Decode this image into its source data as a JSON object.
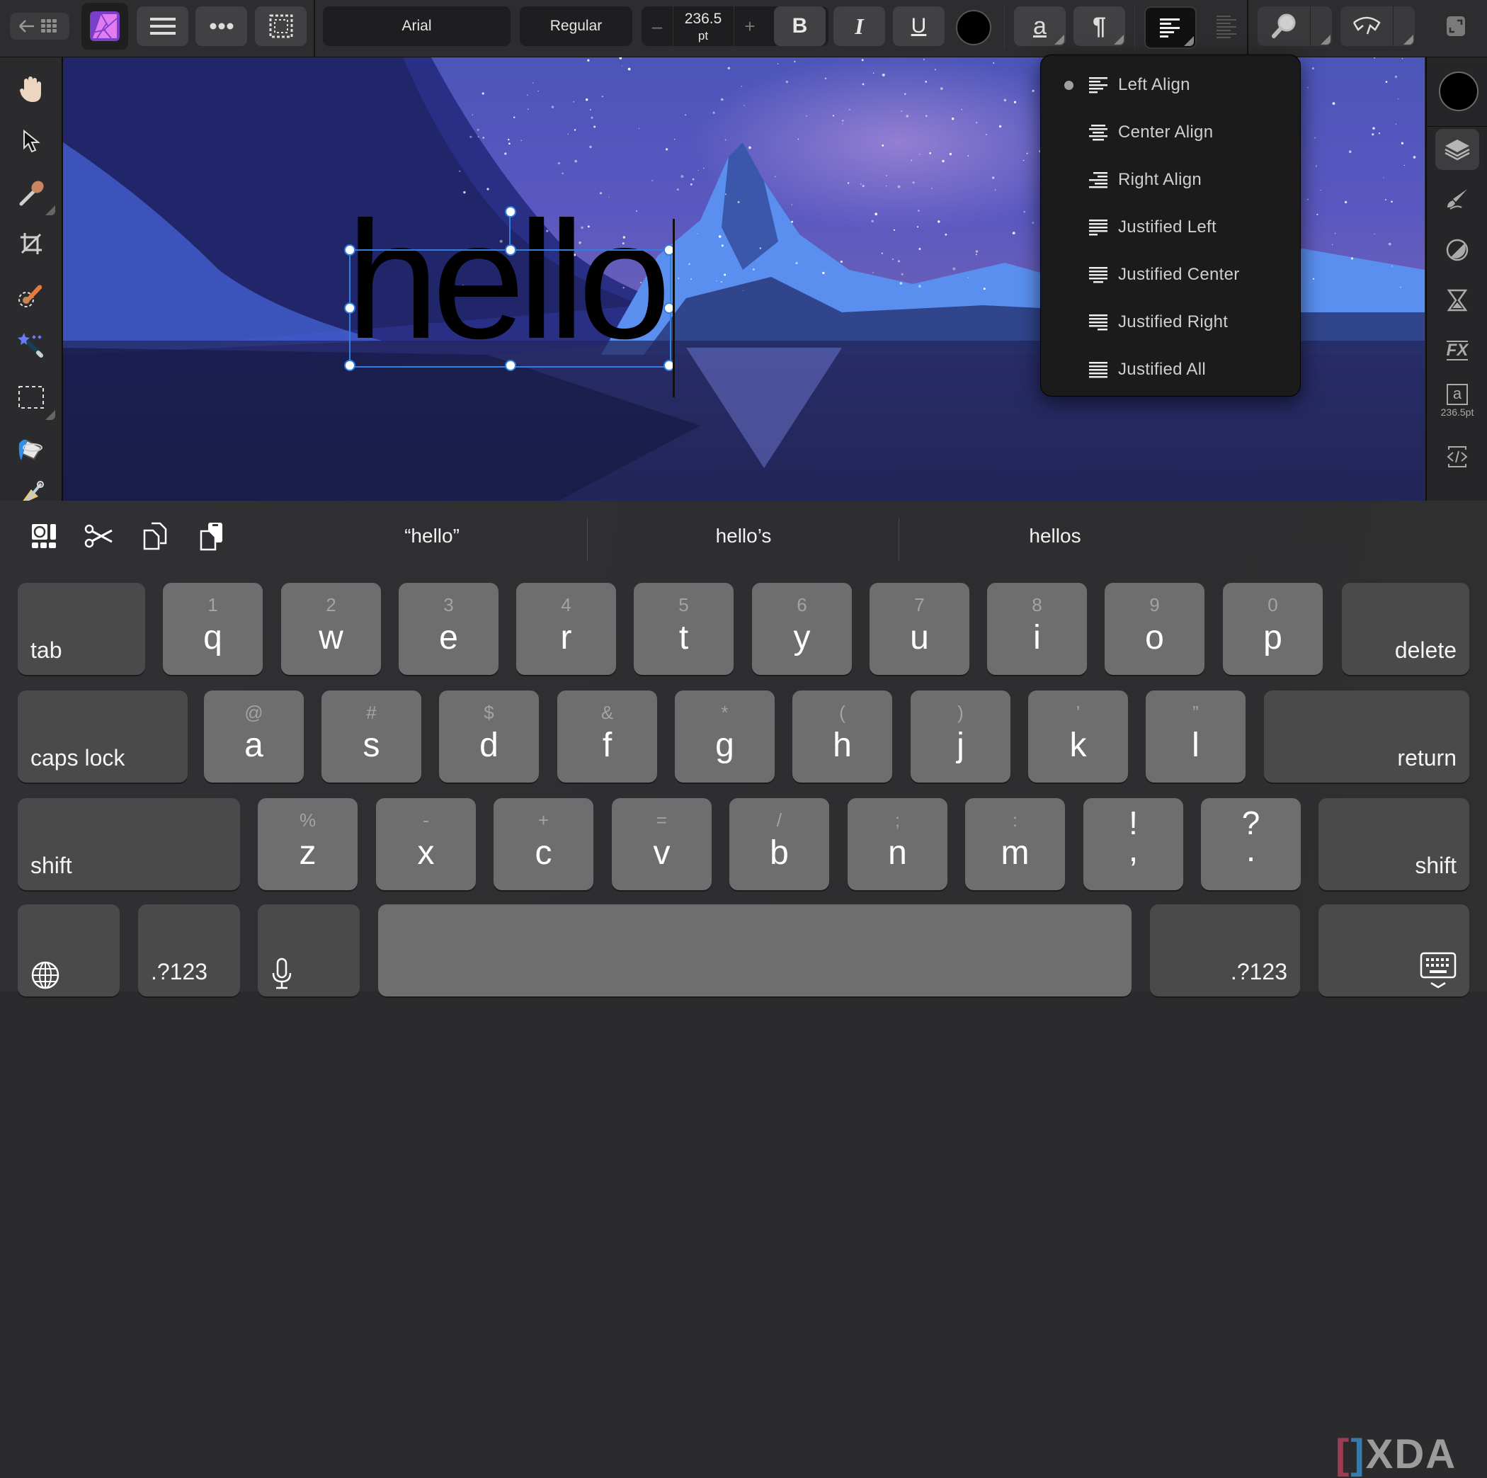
{
  "toolbar": {
    "back_icon": "back-to-gallery-icon",
    "app_logo": "affinity-photo-logo",
    "menu_icon": "hamburger-menu-icon",
    "more_icon": "more-options-icon",
    "selection_icon": "selection-marquee-icon",
    "font_family": "Arial",
    "font_style": "Regular",
    "decrement_label": "–",
    "font_size_value": "236.5",
    "font_size_unit": "pt",
    "increment_label": "+",
    "bold_label": "B",
    "italic_label": "I",
    "underline_label": "U",
    "text_color": "#000000",
    "character_label": "a",
    "paragraph_label": "¶",
    "alignment_icon": "align-left-icon",
    "zoom_icon": "view-zoom-icon",
    "assistant_icon": "assistant-icon",
    "fullscreen_icon": "fullscreen-icon"
  },
  "left_tools": [
    {
      "name": "view-tool",
      "icon": "hand-icon"
    },
    {
      "name": "move-tool",
      "icon": "arrow-pointer-icon"
    },
    {
      "name": "color-picker-tool",
      "icon": "eyedropper-icon"
    },
    {
      "name": "crop-tool",
      "icon": "crop-icon"
    },
    {
      "name": "selection-brush-tool",
      "icon": "selection-brush-icon"
    },
    {
      "name": "flood-select-tool",
      "icon": "magic-wand-icon"
    },
    {
      "name": "rectangular-marquee-tool",
      "icon": "marquee-rect-icon"
    },
    {
      "name": "flood-fill-tool",
      "icon": "paint-bucket-icon"
    },
    {
      "name": "paint-brush-tool",
      "icon": "paint-brush-icon"
    }
  ],
  "canvas": {
    "text_content": "hello",
    "accent_color": "#2f7fe0"
  },
  "align_menu": {
    "selected_index": 0,
    "items": [
      {
        "label": "Left Align",
        "icon": "align-left-icon"
      },
      {
        "label": "Center Align",
        "icon": "align-center-icon"
      },
      {
        "label": "Right Align",
        "icon": "align-right-icon"
      },
      {
        "label": "Justified Left",
        "icon": "justify-left-icon"
      },
      {
        "label": "Justified Center",
        "icon": "justify-center-icon"
      },
      {
        "label": "Justified Right",
        "icon": "justify-right-icon"
      },
      {
        "label": "Justified All",
        "icon": "justify-all-icon"
      }
    ]
  },
  "right_panel": {
    "color_swatch": "#000000",
    "studios": [
      {
        "name": "layers-studio",
        "icon": "layers-icon",
        "active": true
      },
      {
        "name": "brushes-studio",
        "icon": "brush-icon"
      },
      {
        "name": "adjustments-studio",
        "icon": "adjustment-icon"
      },
      {
        "name": "history-studio",
        "icon": "hourglass-icon"
      },
      {
        "name": "effects-studio",
        "icon": "fx-icon"
      },
      {
        "name": "character-studio",
        "icon": "character-icon",
        "caption": "236.5pt"
      },
      {
        "name": "macro-studio",
        "icon": "code-icon"
      }
    ]
  },
  "keyboard": {
    "shortcuts": [
      {
        "name": "emoji-key",
        "icon": "emoji-sticker-icon"
      },
      {
        "name": "cut-button",
        "icon": "scissors-icon"
      },
      {
        "name": "copy-button",
        "icon": "copy-icon"
      },
      {
        "name": "paste-button",
        "icon": "paste-icon"
      }
    ],
    "suggestions": [
      "“hello”",
      "hello’s",
      "hellos"
    ],
    "row1": [
      {
        "main": "tab",
        "type": "fn"
      },
      {
        "main": "q",
        "alt": "1"
      },
      {
        "main": "w",
        "alt": "2"
      },
      {
        "main": "e",
        "alt": "3"
      },
      {
        "main": "r",
        "alt": "4"
      },
      {
        "main": "t",
        "alt": "5"
      },
      {
        "main": "y",
        "alt": "6"
      },
      {
        "main": "u",
        "alt": "7"
      },
      {
        "main": "i",
        "alt": "8"
      },
      {
        "main": "o",
        "alt": "9"
      },
      {
        "main": "p",
        "alt": "0"
      },
      {
        "main": "delete",
        "type": "fn"
      }
    ],
    "row2": [
      {
        "main": "caps lock",
        "type": "fn"
      },
      {
        "main": "a",
        "alt": "@"
      },
      {
        "main": "s",
        "alt": "#"
      },
      {
        "main": "d",
        "alt": "$"
      },
      {
        "main": "f",
        "alt": "&"
      },
      {
        "main": "g",
        "alt": "*"
      },
      {
        "main": "h",
        "alt": "("
      },
      {
        "main": "j",
        "alt": ")"
      },
      {
        "main": "k",
        "alt": "’"
      },
      {
        "main": "l",
        "alt": "”"
      },
      {
        "main": "return",
        "type": "fn"
      }
    ],
    "row3": [
      {
        "main": "shift",
        "type": "fn"
      },
      {
        "main": "z",
        "alt": "%"
      },
      {
        "main": "x",
        "alt": "-"
      },
      {
        "main": "c",
        "alt": "+"
      },
      {
        "main": "v",
        "alt": "="
      },
      {
        "main": "b",
        "alt": "/"
      },
      {
        "main": "n",
        "alt": ";"
      },
      {
        "main": "m",
        "alt": ":"
      },
      {
        "main": ",",
        "alt": "!"
      },
      {
        "main": ".",
        "alt": "?"
      },
      {
        "main": "shift",
        "type": "fn"
      }
    ],
    "row4": [
      {
        "name": "globe-key",
        "icon": "globe-icon"
      },
      {
        "main": ".?123",
        "type": "fn"
      },
      {
        "name": "dictation-key",
        "icon": "microphone-icon"
      },
      {
        "name": "space-key",
        "main": ""
      },
      {
        "main": ".?123",
        "type": "fn"
      },
      {
        "name": "dismiss-keyboard-key",
        "icon": "keyboard-dismiss-icon"
      }
    ]
  },
  "watermark": "XDA"
}
